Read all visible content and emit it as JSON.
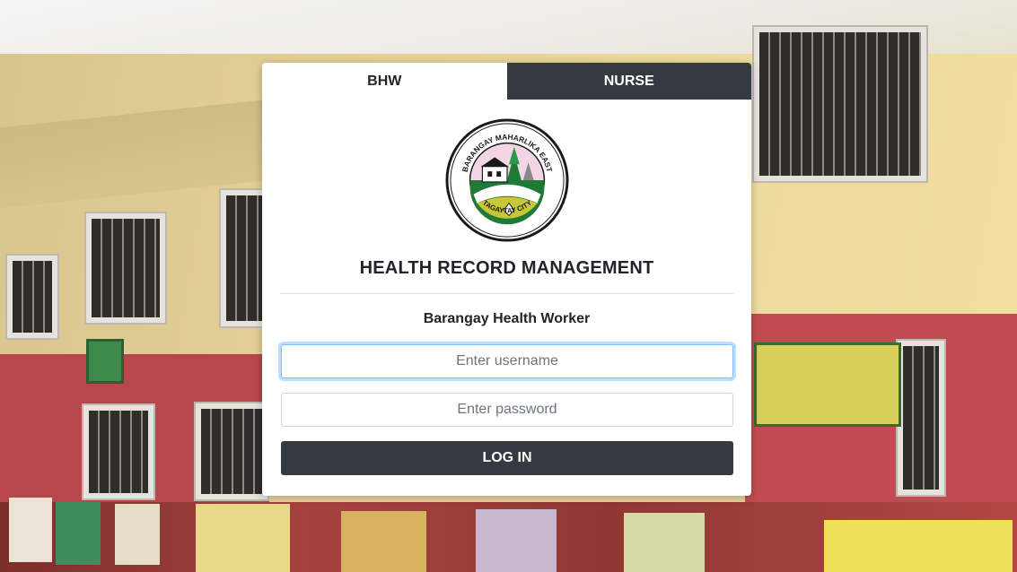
{
  "tabs": [
    {
      "label": "BHW",
      "active": true
    },
    {
      "label": "NURSE",
      "active": false
    }
  ],
  "logo": {
    "top_text": "BARANGAY MAHARLIKA EAST",
    "bottom_text": "TAGAYTAY CITY"
  },
  "title": "HEALTH RECORD MANAGEMENT",
  "subtitle": "Barangay Health Worker",
  "form": {
    "username_placeholder": "Enter username",
    "username_value": "",
    "password_placeholder": "Enter password",
    "password_value": "",
    "submit_label": "LOG IN"
  },
  "colors": {
    "dark": "#343a40",
    "focus_border": "#80bdff",
    "text": "#212529"
  }
}
